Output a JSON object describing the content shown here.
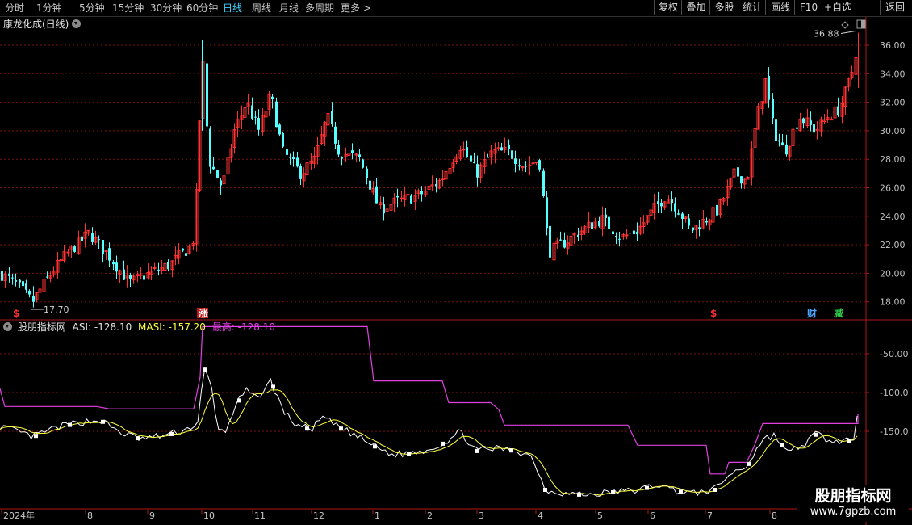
{
  "toolbar": {
    "periods": [
      "分时",
      "1分钟",
      "5分钟",
      "15分钟",
      "30分钟",
      "60分钟",
      "日线",
      "周线",
      "月线",
      "多周期",
      "更多 >"
    ],
    "active_period": "日线",
    "buttons": [
      "复权",
      "叠加",
      "多股",
      "统计",
      "画线",
      "F10",
      "+自选",
      "返回"
    ]
  },
  "stock": {
    "title": "康龙化成(日线)"
  },
  "price_panel": {
    "y_ticks": [
      "36.00",
      "34.00",
      "32.00",
      "30.00",
      "28.00",
      "26.00",
      "24.00",
      "22.00",
      "20.00",
      "18.00"
    ],
    "high_label": "36.88",
    "low_label": "17.70",
    "markers": [
      {
        "text": "$",
        "color": "#ff3030"
      },
      {
        "text": "涨",
        "color": "#ffffff"
      },
      {
        "text": "$",
        "color": "#ff3030"
      },
      {
        "text": "财",
        "color": "#4da6ff"
      },
      {
        "text": "减",
        "color": "#34d24a"
      }
    ]
  },
  "indicator": {
    "name": "股朋指标网",
    "asi": "ASI: -128.10",
    "masi": "MASI: -157.20",
    "high": "最高: -128.10",
    "y_ticks": [
      "-50.00",
      "-100.0",
      "-150.0"
    ],
    "colors": {
      "asi": "#ffffff",
      "masi": "#ffff40",
      "high": "#e040e0"
    }
  },
  "x_axis": {
    "labels": [
      "2024年",
      "8",
      "9",
      "10",
      "11",
      "12",
      "1",
      "2",
      "3",
      "4",
      "5",
      "6",
      "7",
      "8"
    ]
  },
  "watermark": {
    "line1": "股朋指标网",
    "line2": "www.7gpzb.com"
  },
  "colors": {
    "up": "#ff3232",
    "down": "#54ffff",
    "grid": "#7a1010",
    "axis": "#b01818"
  }
}
